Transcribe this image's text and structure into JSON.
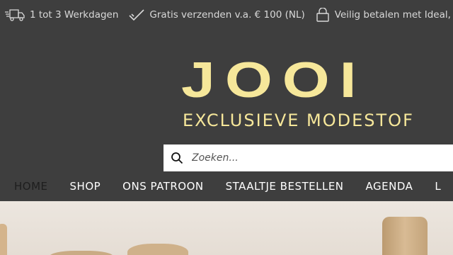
{
  "topbar": {
    "items": [
      {
        "icon": "truck-icon",
        "label": "1 tot 3 Werkdagen"
      },
      {
        "icon": "checkmark-icon",
        "label": "Gratis verzenden v.a. € 100 (NL)"
      },
      {
        "icon": "lock-icon",
        "label": "Veilig betalen met Ideal, Bancontact"
      }
    ]
  },
  "logo": {
    "word": "JOOI",
    "tagline": "EXCLUSIEVE MODESTOF"
  },
  "search": {
    "placeholder": "Zoeken..."
  },
  "nav": {
    "items": [
      "HOME",
      "SHOP",
      "ONS PATROON",
      "STAALTJE BESTELLEN",
      "AGENDA",
      "L"
    ]
  },
  "colors": {
    "background": "#3e3e3e",
    "logo": "#f6e79a",
    "nav_active": "#1e1e1e",
    "nav_text": "#ffffff"
  }
}
